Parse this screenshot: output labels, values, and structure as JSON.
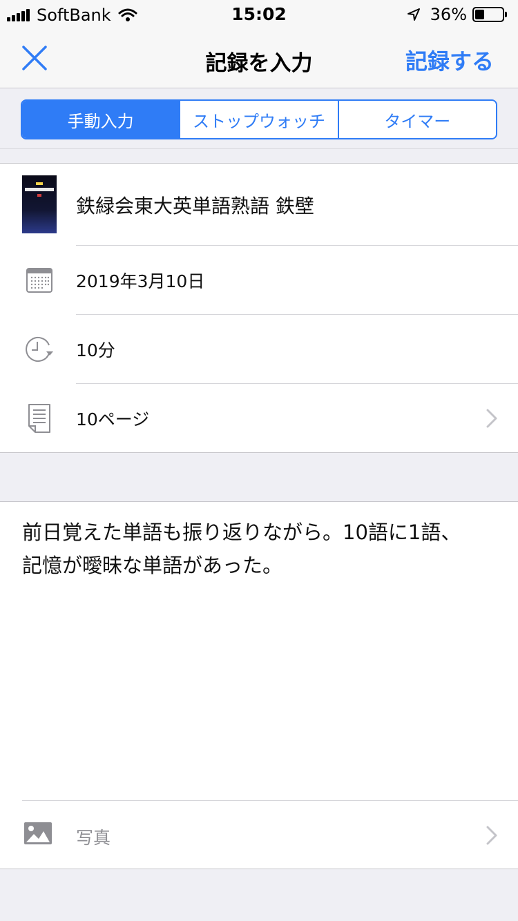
{
  "status_bar": {
    "carrier": "SoftBank",
    "time": "15:02",
    "battery": "36%",
    "battery_level": 0.36
  },
  "nav": {
    "title": "記録を入力",
    "action_label": "記録する"
  },
  "segments": [
    {
      "label": "手動入力",
      "selected": true
    },
    {
      "label": "ストップウォッチ",
      "selected": false
    },
    {
      "label": "タイマー",
      "selected": false
    }
  ],
  "form": {
    "book_title": "鉄緑会東大英単語熟語 鉄壁",
    "date": "2019年3月10日",
    "duration": "10分",
    "pages": "10ページ"
  },
  "memo": {
    "text": "前日覚えた単語も振り返りながら。10語に1語、記憶が曖昧な単語があった。"
  },
  "photo": {
    "label": "写真"
  },
  "colors": {
    "accent": "#2f7cf6",
    "background": "#efeff4"
  }
}
